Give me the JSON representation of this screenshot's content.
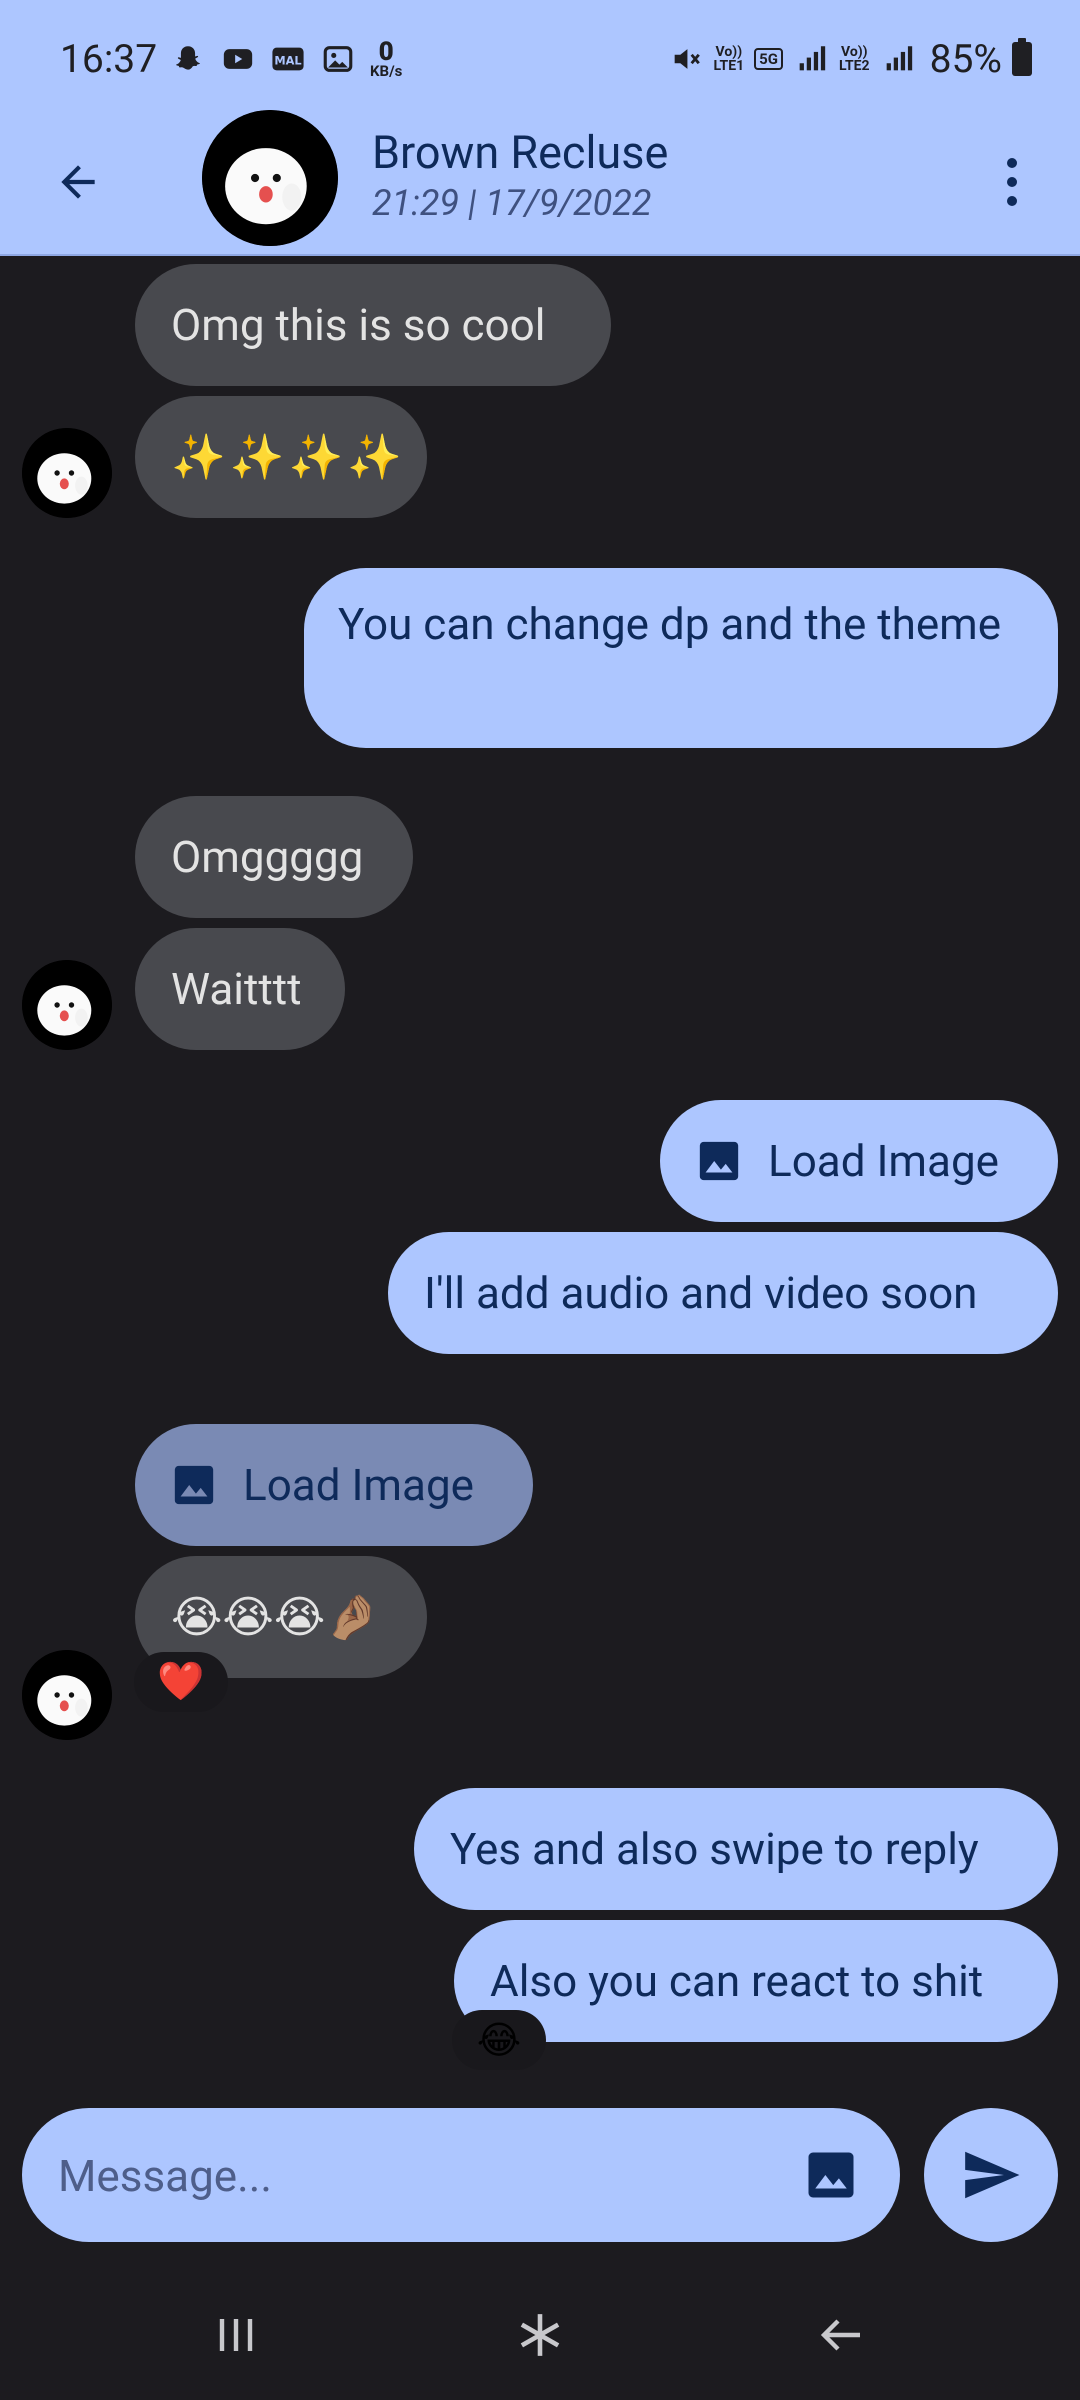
{
  "status_bar": {
    "time": "16:37",
    "data_speed_value": "0",
    "data_speed_unit": "KB/s",
    "sim1_label_top": "Vo))",
    "sim1_label_bottom": "LTE1",
    "network_type": "5G",
    "sim2_label_top": "Vo))",
    "sim2_label_bottom": "LTE2",
    "battery": "85%",
    "left_icons": [
      "snapchat-icon",
      "youtube-icon",
      "mal-icon",
      "gallery-icon"
    ],
    "right_icons": [
      "mute-icon",
      "signal-icon",
      "battery-icon"
    ]
  },
  "header": {
    "contact_name": "Brown Recluse",
    "last_seen": "21:29 | 17/9/2022"
  },
  "messages": [
    {
      "from": "them",
      "text": "Omg this is so cool"
    },
    {
      "from": "them",
      "text": "✨✨✨✨"
    },
    {
      "from": "me",
      "text": "You can change dp and the theme"
    },
    {
      "from": "them",
      "text": "Omggggg"
    },
    {
      "from": "them",
      "text": "Waitttt"
    },
    {
      "from": "me",
      "type": "image",
      "text": "Load Image"
    },
    {
      "from": "me",
      "text": "I'll add audio and video soon"
    },
    {
      "from": "them",
      "type": "image",
      "text": "Load Image"
    },
    {
      "from": "them",
      "text": "😭😭😭🤌🏽"
    },
    {
      "from": "them",
      "reaction": "❤️"
    },
    {
      "from": "me",
      "text": "Yes and also swipe to reply"
    },
    {
      "from": "me",
      "text": "Also you can react to shit",
      "reaction": "😂"
    }
  ],
  "composer": {
    "placeholder": "Message..."
  },
  "colors": {
    "accent": "#adc6ff",
    "background": "#1c1b1f",
    "incoming_bubble": "#48494e",
    "on_accent": "#0e2a5a"
  }
}
